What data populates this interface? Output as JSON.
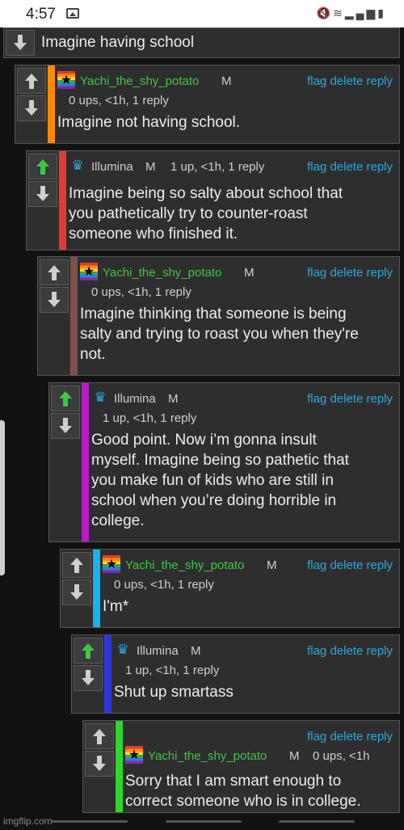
{
  "status_bar": {
    "time": "4:57",
    "icons": [
      "gallery-icon",
      "mute-icon",
      "wifi-icon",
      "signal-icon",
      "battery-icon"
    ]
  },
  "root": {
    "text": "Imagine having school"
  },
  "comments": [
    {
      "user": "Yachi_the_shy_potato",
      "badge": "M",
      "meta": "0 ups, <1h, 1 reply",
      "text": [
        "Imagine not having school."
      ],
      "flag": "flag",
      "delete": "delete",
      "reply": "reply",
      "accent": "#ff8a00",
      "avatar": "rainbow-star",
      "upvoted": false
    },
    {
      "user": "Illumina",
      "badge": "M",
      "meta": "1 up, <1h, 1 reply",
      "text": [
        "Imagine being so salty about school that",
        "you pathetically try to counter-roast",
        "someone who finished it."
      ],
      "flag": "flag",
      "delete": "delete",
      "reply": "reply",
      "accent": "#e53935",
      "avatar": "crown",
      "upvoted": true
    },
    {
      "user": "Yachi_the_shy_potato",
      "badge": "M",
      "meta": "0 ups, <1h, 1 reply",
      "text": [
        "Imagine thinking that someone is being",
        "salty and trying to roast you when they're",
        "not."
      ],
      "flag": "flag",
      "delete": "delete",
      "reply": "reply",
      "accent": "#7b5348",
      "avatar": "rainbow-star",
      "upvoted": false
    },
    {
      "user": "Illumina",
      "badge": "M",
      "meta": "1 up, <1h, 1 reply",
      "text": [
        "Good point. Now i’m gonna insult",
        "myself. Imagine being so pathetic that",
        "you make fun of kids who are still in",
        "school when you’re doing horrible in",
        "college."
      ],
      "flag": "flag",
      "delete": "delete",
      "reply": "reply",
      "accent": "#b71ec3",
      "avatar": "crown",
      "upvoted": true
    },
    {
      "user": "Yachi_the_shy_potato",
      "badge": "M",
      "meta": "0 ups, <1h, 1 reply",
      "text": [
        "I'm*"
      ],
      "flag": "flag",
      "delete": "delete",
      "reply": "reply",
      "accent": "#18b4e8",
      "avatar": "rainbow-star",
      "upvoted": false
    },
    {
      "user": "Illumina",
      "badge": "M",
      "meta": "1 up, <1h, 1 reply",
      "text": [
        "Shut up smartass"
      ],
      "flag": "flag",
      "delete": "delete",
      "reply": "reply",
      "accent": "#2c35e0",
      "avatar": "crown",
      "upvoted": true
    },
    {
      "user": "Yachi_the_shy_potato",
      "badge": "M",
      "meta": "0 ups, <1h",
      "text": [
        "Sorry that I am smart enough to",
        "correct someone who is in college."
      ],
      "flag": "flag",
      "delete": "delete",
      "reply": "reply",
      "accent": "#2ed62e",
      "avatar": "rainbow-star",
      "upvoted": false
    }
  ],
  "watermark": "imgflip.com"
}
